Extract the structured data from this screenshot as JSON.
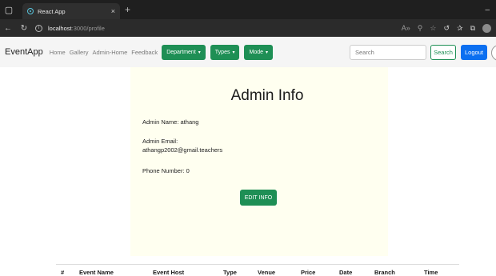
{
  "browser": {
    "tab_title": "React App",
    "tab_close": "×",
    "new_tab": "+",
    "window_minimize": "–",
    "url_host": "localhost",
    "url_path": ":3000/profile"
  },
  "navbar": {
    "brand": "EventApp",
    "links": [
      "Home",
      "Gallery",
      "Admin-Home",
      "Feedback"
    ],
    "dropdowns": [
      "Department",
      "Types",
      "Mode"
    ],
    "search_placeholder": "Search",
    "search_button": "Search",
    "logout_button": "Logout"
  },
  "admin_card": {
    "title": "Admin Info",
    "name_line": "Admin Name: athang",
    "email_label": "Admin Email:",
    "email_value": "athangp2002@gmail.teachers",
    "phone_line": "Phone Number: 0",
    "edit_button": "EDIT INFO"
  },
  "events_table": {
    "headers": [
      "#",
      "Event Name",
      "Event Host",
      "Type",
      "Venue",
      "Price",
      "Date",
      "Branch",
      "Time"
    ]
  },
  "colors": {
    "accent_green": "#1e8f55",
    "logout_blue": "#0b6ff0",
    "card_bg": "#fffff0"
  }
}
